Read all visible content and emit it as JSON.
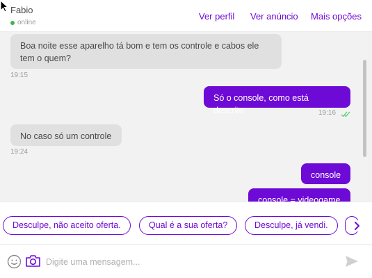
{
  "header": {
    "contact_name": "Fabio",
    "status": "online",
    "links": [
      "Ver perfil",
      "Ver anúncio",
      "Mais opções"
    ]
  },
  "messages": [
    {
      "direction": "in",
      "text": "Boa noite esse aparelho tá bom e tem os controle e cabos ele tem o quem?",
      "time": "19:15"
    },
    {
      "direction": "out",
      "text": "Só o console, como está descrito",
      "time": "19:16",
      "read": true
    },
    {
      "direction": "in",
      "text": "No caso só um controle",
      "time": "19:24"
    },
    {
      "direction": "out",
      "text": "console"
    },
    {
      "direction": "out",
      "text": "console = videogame"
    }
  ],
  "suggestions": [
    "Desculpe, não aceito oferta.",
    "Qual é a sua oferta?",
    "Desculpe, já vendi."
  ],
  "composer": {
    "placeholder": "Digite uma mensagem..."
  },
  "colors": {
    "accent": "#6e0ad6",
    "online": "#3fb34f",
    "incoming_bubble": "#e0e0e0",
    "chat_background": "#f2f2f2"
  },
  "icons": [
    "cursor-arrow-icon",
    "read-receipt-icon",
    "chevron-right-icon",
    "smiley-icon",
    "camera-icon",
    "send-icon"
  ]
}
